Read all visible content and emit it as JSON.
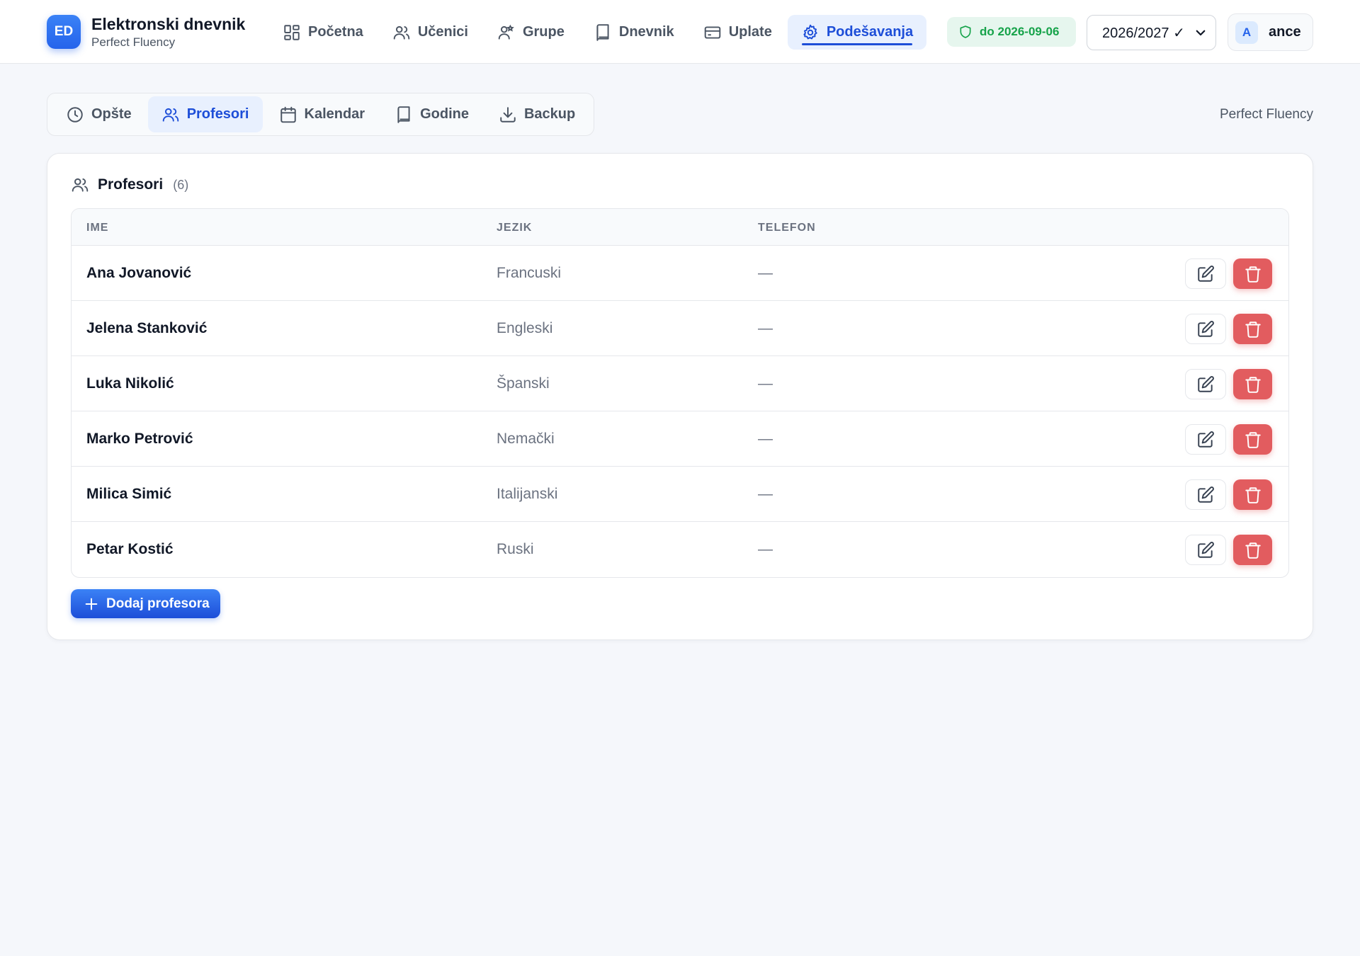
{
  "brand": {
    "badge": "ED",
    "title": "Elektronski dnevnik",
    "subtitle": "Perfect Fluency"
  },
  "nav": [
    {
      "label": "Početna",
      "icon": "dashboard-icon"
    },
    {
      "label": "Učenici",
      "icon": "users-icon"
    },
    {
      "label": "Grupe",
      "icon": "user-group-icon"
    },
    {
      "label": "Dnevnik",
      "icon": "book-icon"
    },
    {
      "label": "Uplate",
      "icon": "credit-card-icon"
    },
    {
      "label": "Podešavanja",
      "icon": "gear-icon",
      "active": true
    }
  ],
  "license": {
    "label": "do 2026-09-06"
  },
  "year_select": {
    "value": "2026/2027 ✓"
  },
  "user": {
    "initial": "A",
    "name": "ance"
  },
  "subtabs": [
    {
      "label": "Opšte",
      "icon": "clock-icon"
    },
    {
      "label": "Profesori",
      "icon": "users-icon",
      "active": true
    },
    {
      "label": "Kalendar",
      "icon": "calendar-icon"
    },
    {
      "label": "Godine",
      "icon": "book-icon"
    },
    {
      "label": "Backup",
      "icon": "download-icon"
    }
  ],
  "org_name": "Perfect Fluency",
  "card": {
    "title": "Profesori",
    "count": "(6)",
    "columns": {
      "name": "IME",
      "language": "JEZIK",
      "phone": "TELEFON"
    },
    "rows": [
      {
        "name": "Ana Jovanović",
        "language": "Francuski",
        "phone": "—"
      },
      {
        "name": "Jelena Stanković",
        "language": "Engleski",
        "phone": "—"
      },
      {
        "name": "Luka Nikolić",
        "language": "Španski",
        "phone": "—"
      },
      {
        "name": "Marko Petrović",
        "language": "Nemački",
        "phone": "—"
      },
      {
        "name": "Milica Simić",
        "language": "Italijanski",
        "phone": "—"
      },
      {
        "name": "Petar Kostić",
        "language": "Ruski",
        "phone": "—"
      }
    ],
    "add_button": "Dodaj profesora"
  },
  "colors": {
    "accent": "#2563eb",
    "active_bg": "#e8f0fe",
    "license_bg": "#e6f6ee",
    "license_text": "#16a34a",
    "delete": "#e25c5f"
  }
}
